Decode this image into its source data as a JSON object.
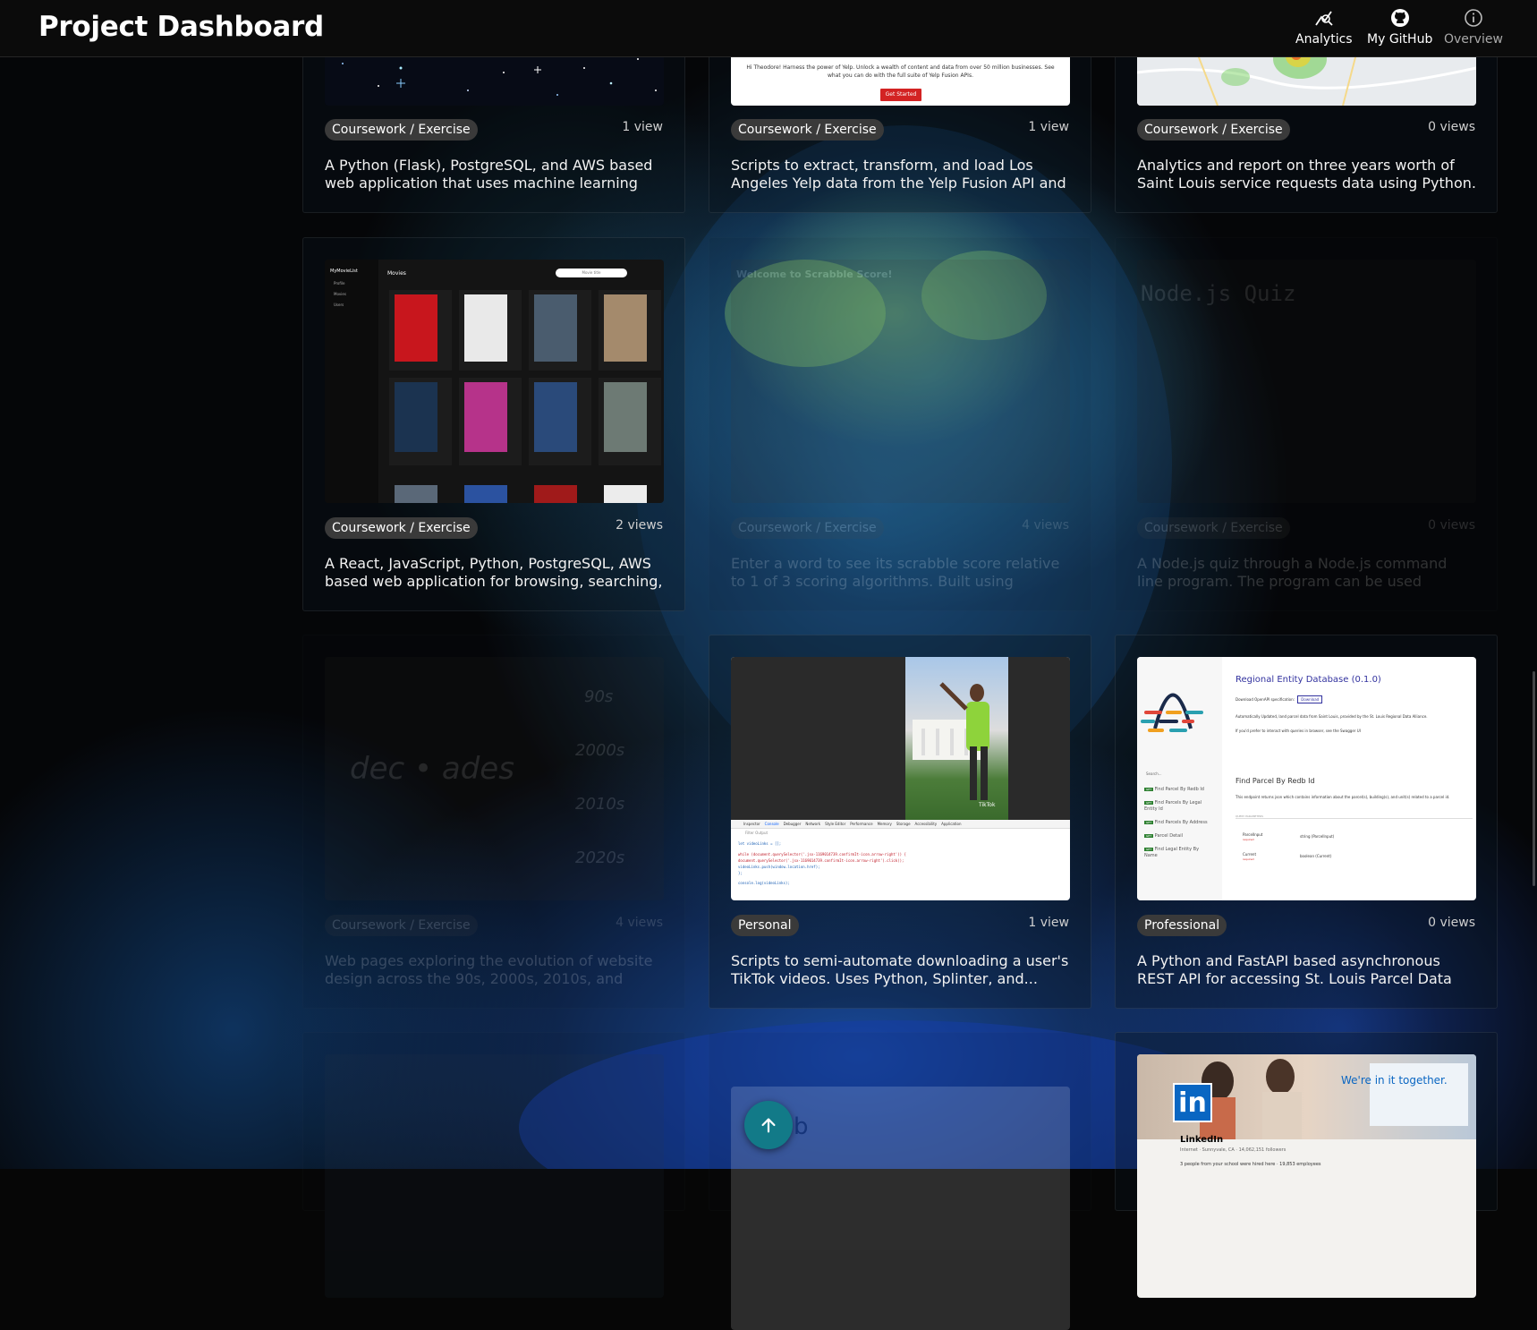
{
  "header": {
    "title": "Project Dashboard",
    "nav": [
      {
        "label": "Analytics",
        "icon": "analytics-icon"
      },
      {
        "label": "My GitHub",
        "icon": "github-icon"
      },
      {
        "label": "Overview",
        "icon": "info-icon"
      }
    ]
  },
  "cards": [
    {
      "category": "Coursework / Exercise",
      "views": "1 view",
      "description": "A Python (Flask), PostgreSQL, and AWS based web application that uses machine learning to..."
    },
    {
      "category": "Coursework / Exercise",
      "views": "1 view",
      "description": "Scripts to extract, transform, and load Los Angeles Yelp data from the Yelp Fusion API and Kaggle.",
      "thumb_text": "Hi Theodore! Harness the power of Yelp. Unlock a wealth of content and data from over 50 million businesses. See what you can do with the full suite of Yelp Fusion APIs.",
      "thumb_button": "Get Started"
    },
    {
      "category": "Coursework / Exercise",
      "views": "0 views",
      "description": "Analytics and report on three years worth of Saint Louis service requests data using Python."
    },
    {
      "category": "Coursework / Exercise",
      "views": "2 views",
      "description": "A React, JavaScript, Python, PostgreSQL, AWS based web application for browsing, searching, and addin...",
      "thumb_brand": "MyMovieList",
      "thumb_heading": "Movies",
      "thumb_search": "Movie title",
      "thumb_menu": [
        "Profile",
        "Movies",
        "Users"
      ]
    },
    {
      "category": "Coursework / Exercise",
      "views": "4 views",
      "description": "Enter a word to see its scrabble score relative to 1 of 3 scoring algorithms. Built using TypeScript, React,...",
      "thumb_title": "Welcome to Scrabble Score!"
    },
    {
      "category": "Coursework / Exercise",
      "views": "0 views",
      "description": "A Node.js quiz through a Node.js command line program. The program can be used directly in a...",
      "thumb_title": "Node.js Quiz"
    },
    {
      "category": "Coursework / Exercise",
      "views": "4 views",
      "description": "Web pages exploring the evolution of website design across the 90s, 2000s, 2010s, and 2020s.",
      "thumb_title": "dec • ades",
      "thumb_eras": [
        "90s",
        "2000s",
        "2010s",
        "2020s"
      ]
    },
    {
      "category": "Personal",
      "views": "1 view",
      "description": "Scripts to semi-automate downloading a user's TikTok videos. Uses Python, Splinter, and...",
      "thumb_tabs": [
        "Inspector",
        "Console",
        "Debugger",
        "Network",
        "Style Editor",
        "Performance",
        "Memory",
        "Storage",
        "Accessibility",
        "Application"
      ],
      "thumb_filter": "Filter Output",
      "thumb_watermark": "TikTok",
      "thumb_code": [
        "let videoLinks = [];",
        "while (document.querySelector('.jsx-1169014739.confirmIt-icon.arrow-right')) {",
        "  document.querySelector('.jsx-1169014739.confirmIt-icon.arrow-right').click();",
        "  videoLinks.push(window.location.href);",
        "};",
        "console.log(videoLinks);"
      ]
    },
    {
      "category": "Professional",
      "views": "0 views",
      "description": "A Python and FastAPI based asynchronous REST API for accessing St. Louis Parcel Data stored in the...",
      "thumb_title": "Regional Entity Database (0.1.0)",
      "thumb_download": "Download",
      "thumb_spec": "Download OpenAPI specification:",
      "thumb_line1": "Automatically Updated, land parcel data from Saint Louis, provided by the St. Louis Regional Data Alliance.",
      "thumb_line2": "If you'd prefer to interact with queries in browser, see the Swagger UI",
      "thumb_search": "Search...",
      "thumb_section": "Find Parcel By Redb Id",
      "thumb_section_desc": "This endpoint returns json which contains information about the parcel(s), building(s), and unit(s) related to a parcel id.",
      "thumb_query": "QUERY PARAMETERS",
      "thumb_params": [
        {
          "name": "ParcelInput",
          "req": "required",
          "type": "string (ParcelInput)"
        },
        {
          "name": "Current",
          "req": "required",
          "type": "boolean (Current)"
        }
      ],
      "thumb_endpoints": [
        "Find Parcel By Redb Id",
        "Find Parcels By Legal Entity Id",
        "Find Parcels By Address",
        "Parcel Detail",
        "Find Legal Entity By Name"
      ],
      "thumb_method": "GET"
    },
    {
      "category": "",
      "views": "",
      "description": ""
    },
    {
      "category": "",
      "views": "",
      "description": "",
      "thumb_text": "b"
    },
    {
      "category": "",
      "views": "",
      "description": "",
      "thumb_tagline": "We're in it together.",
      "thumb_company": "LinkedIn",
      "thumb_meta": "Internet · Sunnyvale, CA · 14,062,151 followers",
      "thumb_connections": "3 people from your school were hired here · 19,853 employees"
    }
  ],
  "colors": {
    "accent": "#127a88",
    "chip": "#3a3a3a",
    "header": "#0b0b0b"
  }
}
